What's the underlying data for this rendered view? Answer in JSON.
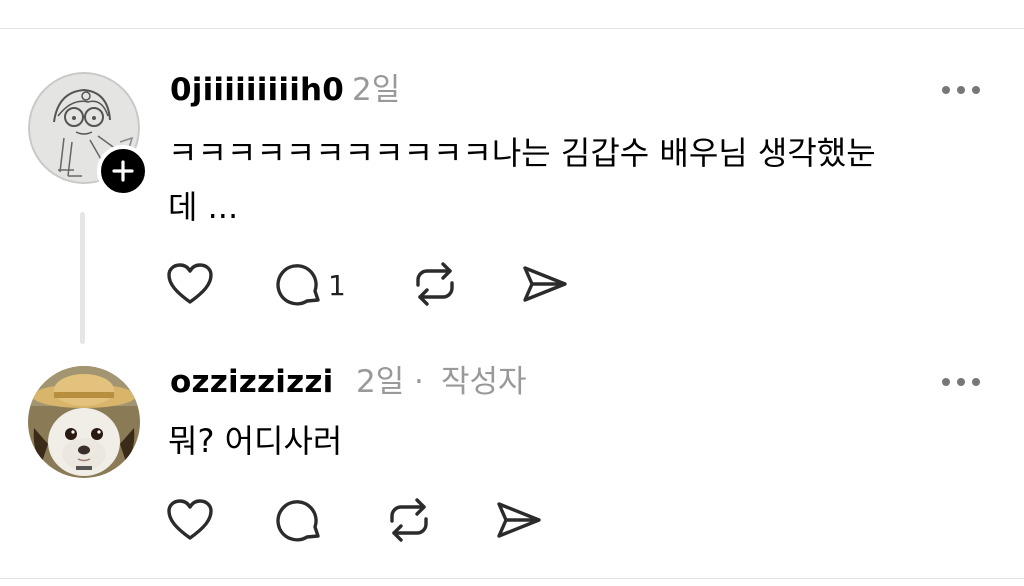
{
  "comments": [
    {
      "username": "0jiiiiiiiiih0",
      "time": "2일",
      "text_line1": "ㅋㅋㅋㅋㅋㅋㅋㅋㅋㅋㅋ나는 김갑수 배우님 생각했눈",
      "text_line2": "데 ...",
      "reply_count": "1",
      "avatar_icon": "sketch-drawing-avatar",
      "follow_icon": "plus-icon"
    },
    {
      "username": "ozzizzizzi",
      "time": "2일",
      "separator": "·",
      "author_badge": "작성자",
      "text": "뭐? 어디사러",
      "avatar_icon": "dog-straw-hat-avatar"
    }
  ],
  "icons": [
    "heart-icon",
    "comment-icon",
    "repost-icon",
    "share-icon",
    "more-icon"
  ],
  "colors": {
    "meta_gray": "#999999",
    "icon_dark": "#2b2b2b",
    "divider": "#e3e3e3"
  }
}
